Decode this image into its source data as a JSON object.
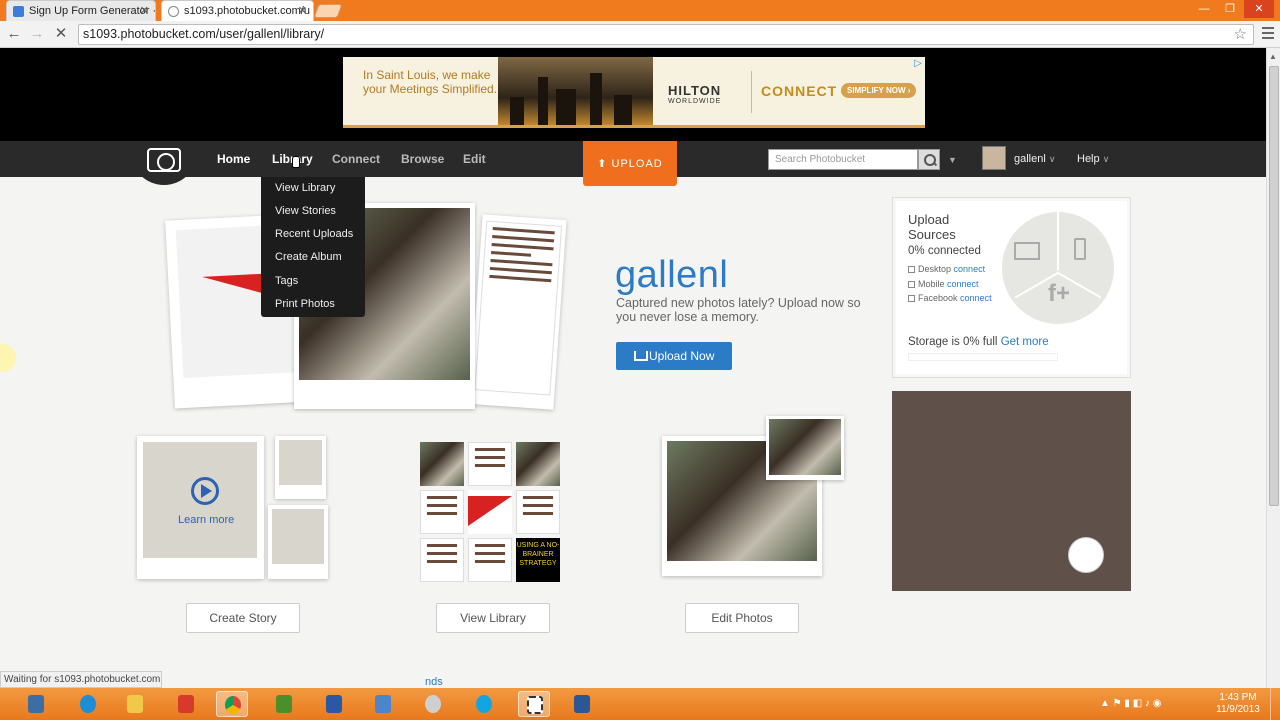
{
  "browser": {
    "tabs": [
      {
        "title": "Sign Up Form Generator ·",
        "active": false
      },
      {
        "title": "s1093.photobucket.com/u",
        "active": true
      }
    ],
    "url": "s1093.photobucket.com/user/gallenl/library/",
    "status": "Waiting for s1093.photobucket.com..."
  },
  "ad": {
    "tagline": "In Saint Louis, we make your Meetings Simplified.",
    "brand": "HILTON",
    "brand_sub": "WORLDWIDE",
    "connect": "CONNECT",
    "cta": "SIMPLIFY NOW ›"
  },
  "nav": {
    "links": [
      "Home",
      "Library",
      "Connect",
      "Browse",
      "Edit"
    ],
    "active": "Home",
    "upload": "UPLOAD",
    "search_placeholder": "Search Photobucket",
    "user": "gallenl",
    "help": "Help"
  },
  "library_menu": [
    "View Library",
    "View Stories",
    "Recent Uploads",
    "Create Album",
    "Tags",
    "Print Photos"
  ],
  "profile": {
    "username": "gallenl",
    "tagline": "Captured new photos lately? Upload now so you never lose a memory.",
    "upload_button": "Upload Now"
  },
  "upload_sources": {
    "title_line1": "Upload",
    "title_line2": "Sources",
    "connected": "0% connected",
    "items": [
      {
        "label": "Desktop",
        "action": "connect"
      },
      {
        "label": "Mobile",
        "action": "connect"
      },
      {
        "label": "Facebook",
        "action": "connect"
      }
    ],
    "storage": "Storage is 0% full",
    "get_more": "Get more"
  },
  "features": {
    "learn_more": "Learn more",
    "create_story": "Create Story",
    "view_library": "View Library",
    "edit_photos": "Edit Photos",
    "strategy_text": "USING A NO-BRAINER STRATEGY",
    "hidden_link": "nds"
  },
  "taskbar": {
    "time": "1:43 PM",
    "date": "11/9/2013"
  },
  "colors": {
    "accent": "#2b7bc7",
    "upload_orange": "#f06f1f",
    "nav_bg": "#2a2a2a",
    "taskbar": "#e8781c"
  }
}
